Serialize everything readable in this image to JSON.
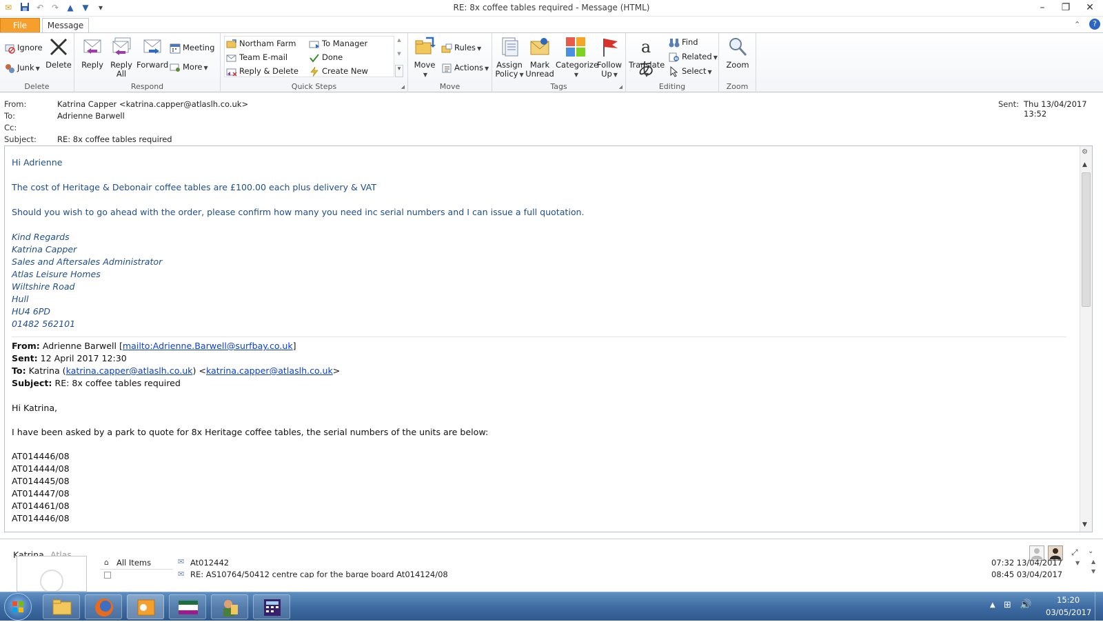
{
  "window": {
    "title": "RE: 8x coffee tables required  -  Message (HTML)"
  },
  "tabs": {
    "file": "File",
    "message": "Message"
  },
  "ribbon": {
    "delete_group": {
      "label": "Delete",
      "ignore": "Ignore",
      "junk": "Junk",
      "delete": "Delete"
    },
    "respond_group": {
      "label": "Respond",
      "reply": "Reply",
      "reply_all_1": "Reply",
      "reply_all_2": "All",
      "forward": "Forward",
      "meeting": "Meeting",
      "more": "More"
    },
    "quicksteps_group": {
      "label": "Quick Steps",
      "items": [
        "Northam Farm",
        "Team E-mail",
        "Reply & Delete",
        "To Manager",
        "Done",
        "Create New"
      ]
    },
    "move_group": {
      "label": "Move",
      "move": "Move",
      "rules": "Rules",
      "actions": "Actions"
    },
    "tags_group": {
      "label": "Tags",
      "assign_1": "Assign",
      "assign_2": "Policy",
      "mark_1": "Mark",
      "mark_2": "Unread",
      "categorize": "Categorize",
      "follow_1": "Follow",
      "follow_2": "Up"
    },
    "editing_group": {
      "label": "Editing",
      "translate": "Translate",
      "find": "Find",
      "related": "Related",
      "select": "Select"
    },
    "zoom_group": {
      "label": "Zoom",
      "zoom": "Zoom"
    }
  },
  "header": {
    "from_label": "From:",
    "from_value": "Katrina Capper <katrina.capper@atlaslh.co.uk>",
    "to_label": "To:",
    "to_value": "Adrienne Barwell",
    "cc_label": "Cc:",
    "subject_label": "Subject:",
    "subject_value": "RE: 8x coffee tables required",
    "sent_label": "Sent:",
    "sent_value": "Thu 13/04/2017 13:52"
  },
  "body": {
    "greeting": "Hi Adrienne",
    "line1": "The cost of Heritage & Debonair coffee tables are £100.00 each plus delivery & VAT",
    "line2": "Should you wish to go ahead with the order, please confirm how many you need inc serial numbers and I can issue a full quotation.",
    "signature": [
      "Kind Regards",
      "Katrina Capper",
      "Sales and Aftersales Administrator",
      "Atlas Leisure Homes",
      "Wiltshire Road",
      "Hull",
      "HU4 6PD",
      "01482 562101"
    ],
    "quoted": {
      "from_label": "From:",
      "from_name": " Adrienne Barwell [",
      "from_link": "mailto:Adrienne.Barwell@surfbay.co.uk",
      "from_end": "]",
      "sent_label": "Sent:",
      "sent_value": " 12 April 2017 12:30",
      "to_label": "To:",
      "to_name": " Katrina (",
      "to_link1": "katrina.capper@atlaslh.co.uk",
      "to_mid": ") <",
      "to_link2": "katrina.capper@atlaslh.co.uk",
      "to_end": ">",
      "subject_label": "Subject:",
      "subject_value": " RE: 8x coffee tables required",
      "greeting": "Hi Katrina,",
      "intro": "I have been asked by a park to quote for 8x Heritage coffee tables, the serial numbers of the units are below:",
      "serials": [
        "AT014446/08",
        "AT014444/08",
        "AT014445/08",
        "AT014447/08",
        "AT014461/08",
        "AT014446/08"
      ]
    }
  },
  "people_pane": {
    "name": "Katrina",
    "company": "Atlas",
    "all_items": "All Items",
    "rows": [
      {
        "subject": "At012442",
        "time": "07:32  13/04/2017"
      },
      {
        "subject": "RE: AS10764/50412 centre cap for the barge board At014124/08",
        "time": "08:45  03/04/2017"
      }
    ]
  },
  "taskbar": {
    "time": "15:20",
    "date": "03/05/2017"
  },
  "colors": {
    "file_tab": "#f5a02d",
    "body_blue": "#1f4e8c",
    "link": "#0b3fd6",
    "taskbar": "#3d6aa0"
  }
}
